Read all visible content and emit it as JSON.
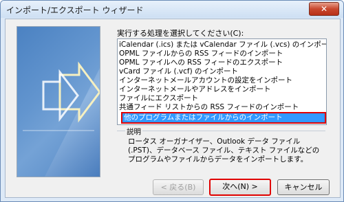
{
  "window": {
    "title": "インポート/エクスポート ウィザード",
    "close_label": "✕"
  },
  "main": {
    "prompt": "実行する処理を選択してください(C):",
    "items": [
      {
        "label": "iCalendar (.ics) または vCalendar ファイル (.vcs) のインポート"
      },
      {
        "label": "OPML ファイルからの RSS フィードのインポート"
      },
      {
        "label": "OPML ファイルへの RSS フィードのエクスポート"
      },
      {
        "label": "vCard ファイル (.vcf) のインポート"
      },
      {
        "label": "インターネットメールアカウントの設定をインポート"
      },
      {
        "label": "インターネットメールやアドレスをインポート"
      },
      {
        "label": "ファイルにエクスポート"
      },
      {
        "label": "共通フィード リストからの RSS フィードのインポート"
      },
      {
        "label": "他のプログラムまたはファイルからのインポート"
      }
    ],
    "selected_index": 8,
    "description": {
      "legend": "説明",
      "text": "ロータス オーガナイザー、Outlook データ ファイル (.PST)、データベース ファイル、テキスト ファイルなどのプログラムやファイルからデータをインポートします。"
    }
  },
  "buttons": {
    "back": "< 戻る(B)",
    "next": "次へ(N) >",
    "cancel": "キャンセル"
  }
}
